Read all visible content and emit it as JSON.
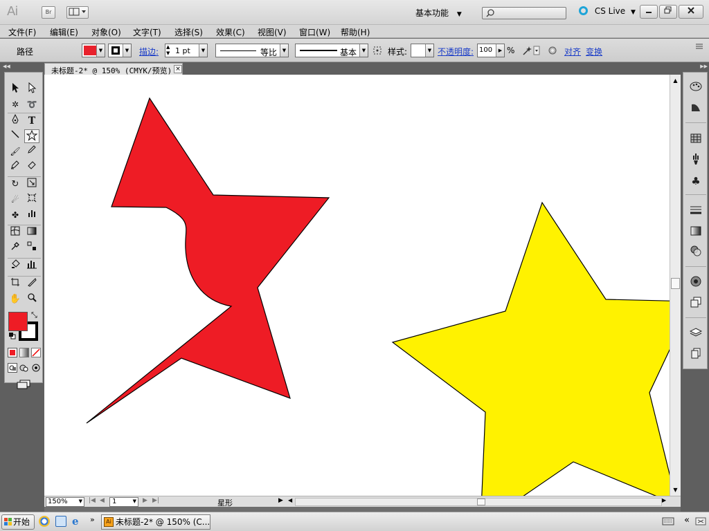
{
  "app": {
    "logo": "Ai",
    "bridge_label": "Br",
    "workspace": "基本功能",
    "cs_live": "CS Live"
  },
  "menu": [
    "文件(F)",
    "编辑(E)",
    "对象(O)",
    "文字(T)",
    "选择(S)",
    "效果(C)",
    "视图(V)",
    "窗口(W)",
    "帮助(H)"
  ],
  "control_bar": {
    "selection_type": "路径",
    "fill_color": "#e8212c",
    "stroke_color": "#000000",
    "stroke_label": "描边:",
    "stroke_weight": "1 pt",
    "stroke_profile": "等比",
    "brush": "基本",
    "style_label": "样式:",
    "opacity_label": "不透明度:",
    "opacity_value": "100",
    "percent": "%",
    "align_label": "对齐",
    "transform_label": "变换"
  },
  "document": {
    "tab_title": "未标题-2* @ 150% (CMYK/预览)",
    "close_glyph": "×"
  },
  "shapes": {
    "red_fill": "#ee1c25",
    "yellow_fill": "#fff200",
    "outline": "#000000"
  },
  "status": {
    "zoom": "150%",
    "artboard": "1",
    "tool_name": "星形"
  },
  "taskbar": {
    "start": "开始",
    "task_item": "未标题-2* @ 150% (C..."
  }
}
